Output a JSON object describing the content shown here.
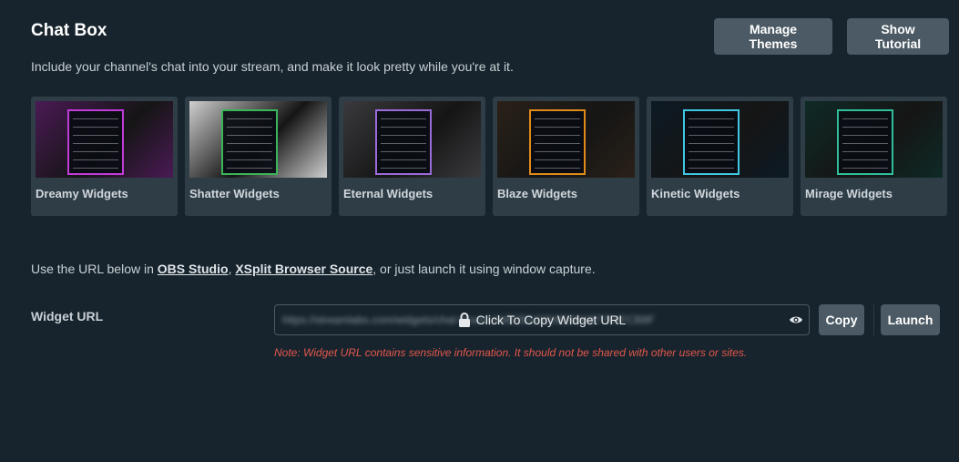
{
  "header": {
    "title": "Chat Box",
    "subtitle": "Include your channel's chat into your stream, and make it look pretty while you're at it.",
    "manage_themes_label": "Manage Themes",
    "show_tutorial_label": "Show Tutorial"
  },
  "themes": [
    {
      "label": "Dreamy Widgets",
      "accent": "#c13bd8",
      "bg": "#4a1a55"
    },
    {
      "label": "Shatter Widgets",
      "accent": "#3bb55a",
      "bg": "#cfcfcf"
    },
    {
      "label": "Eternal Widgets",
      "accent": "#9a6bd8",
      "bg": "#3a3a3e"
    },
    {
      "label": "Blaze Widgets",
      "accent": "#e08a1a",
      "bg": "#2a2118"
    },
    {
      "label": "Kinetic Widgets",
      "accent": "#3fc6e0",
      "bg": "#0d1a24"
    },
    {
      "label": "Mirage Widgets",
      "accent": "#2fbf9a",
      "bg": "#0f2a26"
    }
  ],
  "url_section": {
    "prefix": "Use the URL below in ",
    "obs_link": "OBS Studio",
    "separator": ", ",
    "xsplit_link": "XSplit Browser Source",
    "suffix": ", or just launch it using window capture.",
    "widget_url_label": "Widget URL",
    "url_value": "https://streamlabs.com/widgets/chat-box/v1/A8E35102D9ED9AB7764FCB8F",
    "overlay_text": "Click To Copy Widget URL",
    "copy_label": "Copy",
    "launch_label": "Launch",
    "note": "Note: Widget URL contains sensitive information. It should not be shared with other users or sites."
  }
}
